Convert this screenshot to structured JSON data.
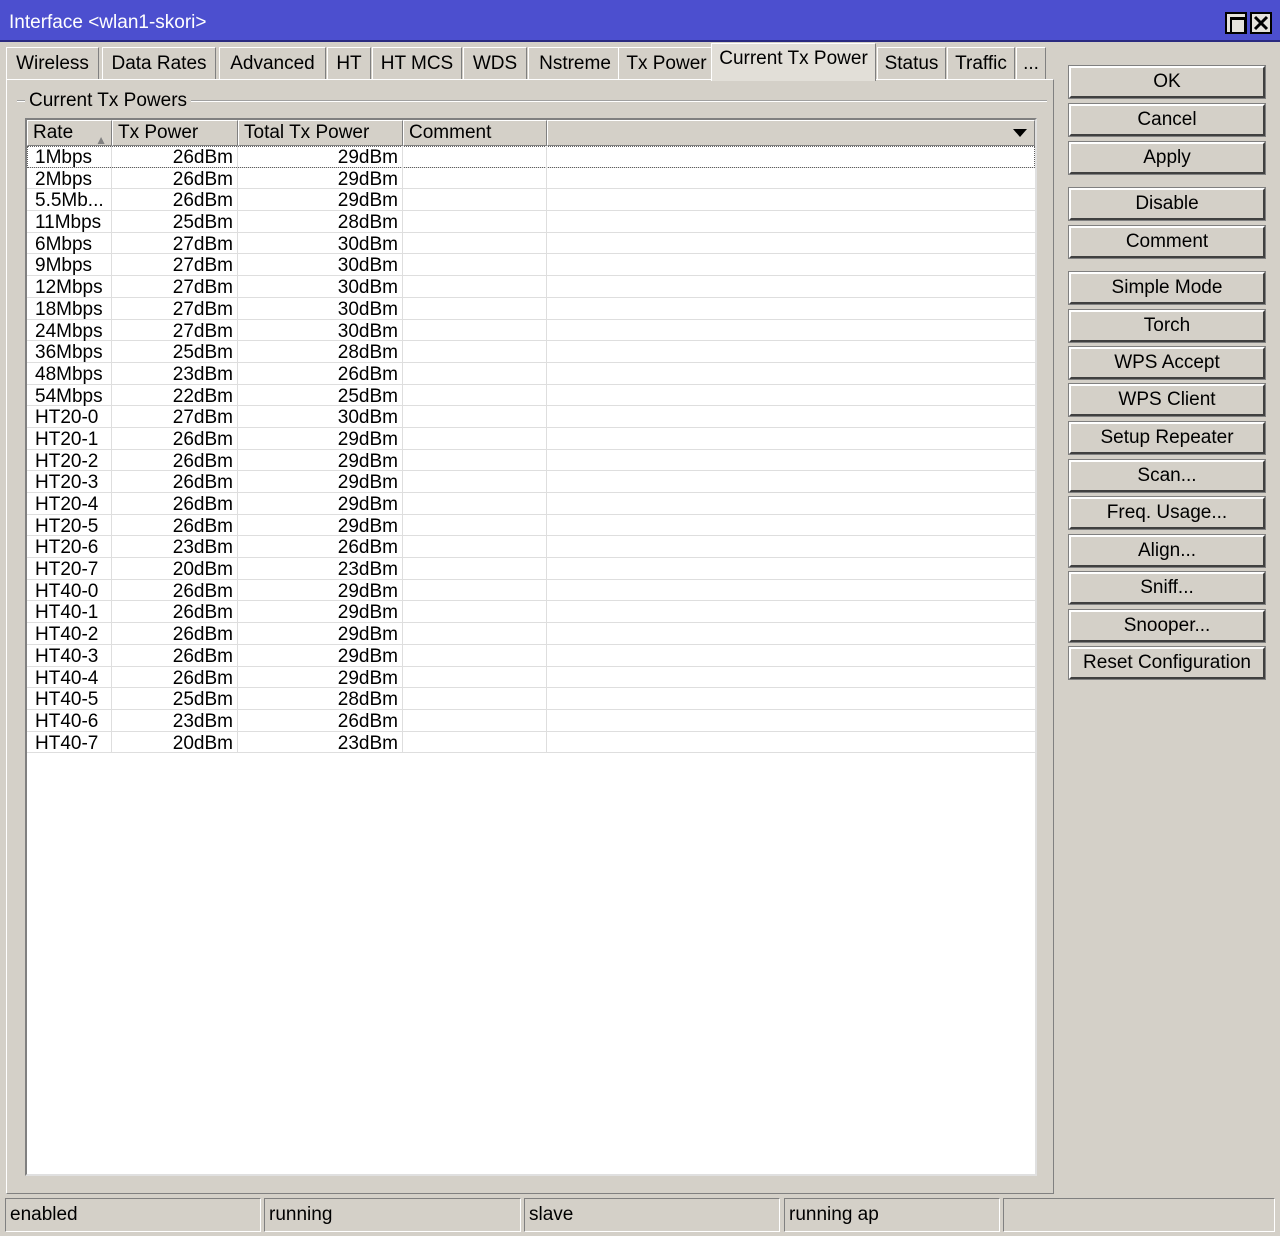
{
  "window": {
    "title": "Interface <wlan1-skori>"
  },
  "tabs": [
    {
      "label": "Wireless"
    },
    {
      "label": "Data Rates"
    },
    {
      "label": "Advanced"
    },
    {
      "label": "HT"
    },
    {
      "label": "HT MCS"
    },
    {
      "label": "WDS"
    },
    {
      "label": "Nstreme"
    },
    {
      "label": "Tx Power"
    },
    {
      "label": "Current Tx Power",
      "active": true
    },
    {
      "label": "Status"
    },
    {
      "label": "Traffic"
    },
    {
      "label": "..."
    }
  ],
  "group": {
    "label": "Current Tx Powers"
  },
  "table": {
    "columns": [
      "Rate",
      "Tx Power",
      "Total Tx Power",
      "Comment"
    ],
    "sorted_column": "Rate",
    "rows": [
      {
        "rate": "1Mbps",
        "tx": "26dBm",
        "total": "29dBm",
        "comment": ""
      },
      {
        "rate": "2Mbps",
        "tx": "26dBm",
        "total": "29dBm",
        "comment": ""
      },
      {
        "rate": "5.5Mb...",
        "tx": "26dBm",
        "total": "29dBm",
        "comment": ""
      },
      {
        "rate": "11Mbps",
        "tx": "25dBm",
        "total": "28dBm",
        "comment": ""
      },
      {
        "rate": "6Mbps",
        "tx": "27dBm",
        "total": "30dBm",
        "comment": ""
      },
      {
        "rate": "9Mbps",
        "tx": "27dBm",
        "total": "30dBm",
        "comment": ""
      },
      {
        "rate": "12Mbps",
        "tx": "27dBm",
        "total": "30dBm",
        "comment": ""
      },
      {
        "rate": "18Mbps",
        "tx": "27dBm",
        "total": "30dBm",
        "comment": ""
      },
      {
        "rate": "24Mbps",
        "tx": "27dBm",
        "total": "30dBm",
        "comment": ""
      },
      {
        "rate": "36Mbps",
        "tx": "25dBm",
        "total": "28dBm",
        "comment": ""
      },
      {
        "rate": "48Mbps",
        "tx": "23dBm",
        "total": "26dBm",
        "comment": ""
      },
      {
        "rate": "54Mbps",
        "tx": "22dBm",
        "total": "25dBm",
        "comment": ""
      },
      {
        "rate": "HT20-0",
        "tx": "27dBm",
        "total": "30dBm",
        "comment": ""
      },
      {
        "rate": "HT20-1",
        "tx": "26dBm",
        "total": "29dBm",
        "comment": ""
      },
      {
        "rate": "HT20-2",
        "tx": "26dBm",
        "total": "29dBm",
        "comment": ""
      },
      {
        "rate": "HT20-3",
        "tx": "26dBm",
        "total": "29dBm",
        "comment": ""
      },
      {
        "rate": "HT20-4",
        "tx": "26dBm",
        "total": "29dBm",
        "comment": ""
      },
      {
        "rate": "HT20-5",
        "tx": "26dBm",
        "total": "29dBm",
        "comment": ""
      },
      {
        "rate": "HT20-6",
        "tx": "23dBm",
        "total": "26dBm",
        "comment": ""
      },
      {
        "rate": "HT20-7",
        "tx": "20dBm",
        "total": "23dBm",
        "comment": ""
      },
      {
        "rate": "HT40-0",
        "tx": "26dBm",
        "total": "29dBm",
        "comment": ""
      },
      {
        "rate": "HT40-1",
        "tx": "26dBm",
        "total": "29dBm",
        "comment": ""
      },
      {
        "rate": "HT40-2",
        "tx": "26dBm",
        "total": "29dBm",
        "comment": ""
      },
      {
        "rate": "HT40-3",
        "tx": "26dBm",
        "total": "29dBm",
        "comment": ""
      },
      {
        "rate": "HT40-4",
        "tx": "26dBm",
        "total": "29dBm",
        "comment": ""
      },
      {
        "rate": "HT40-5",
        "tx": "25dBm",
        "total": "28dBm",
        "comment": ""
      },
      {
        "rate": "HT40-6",
        "tx": "23dBm",
        "total": "26dBm",
        "comment": ""
      },
      {
        "rate": "HT40-7",
        "tx": "20dBm",
        "total": "23dBm",
        "comment": ""
      }
    ]
  },
  "buttons": [
    {
      "label": "OK",
      "name": "ok-button"
    },
    {
      "label": "Cancel",
      "name": "cancel-button"
    },
    {
      "label": "Apply",
      "name": "apply-button"
    },
    {
      "label": "Disable",
      "name": "disable-button"
    },
    {
      "label": "Comment",
      "name": "comment-button"
    },
    {
      "label": "Simple Mode",
      "name": "simple-mode-button"
    },
    {
      "label": "Torch",
      "name": "torch-button"
    },
    {
      "label": "WPS Accept",
      "name": "wps-accept-button"
    },
    {
      "label": "WPS Client",
      "name": "wps-client-button"
    },
    {
      "label": "Setup Repeater",
      "name": "setup-repeater-button"
    },
    {
      "label": "Scan...",
      "name": "scan-button"
    },
    {
      "label": "Freq. Usage...",
      "name": "freq-usage-button"
    },
    {
      "label": "Align...",
      "name": "align-button"
    },
    {
      "label": "Sniff...",
      "name": "sniff-button"
    },
    {
      "label": "Snooper...",
      "name": "snooper-button"
    },
    {
      "label": "Reset Configuration",
      "name": "reset-configuration-button"
    }
  ],
  "status": [
    "enabled",
    "running",
    "slave",
    "running ap",
    ""
  ]
}
